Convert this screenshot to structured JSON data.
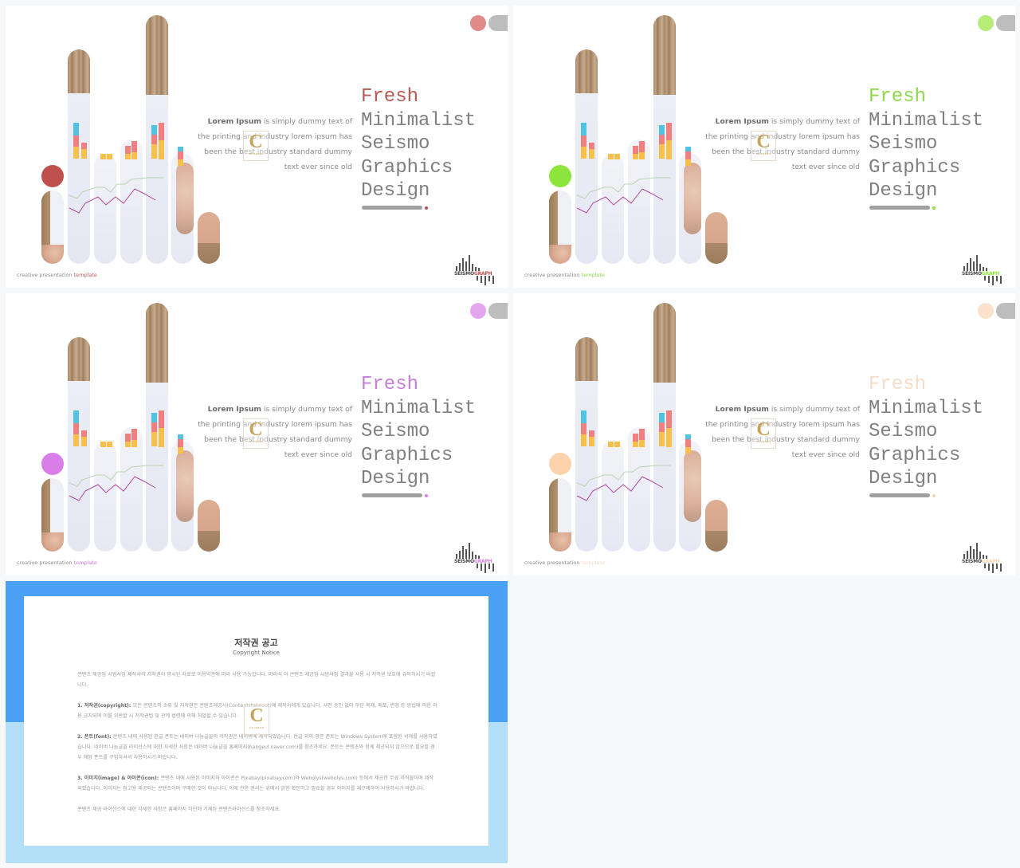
{
  "slides": [
    {
      "accent": "#c0504d",
      "top_dot_color": "#e08a8a",
      "title_color": "#b55a55",
      "body": {
        "bold": "Lorem Ipsum",
        "text": " is simply dummy text of the printing and industry lorem ipsum has been the best industry standard dummy text ever since old"
      },
      "title_lines": [
        "Fresh",
        "Minimalist",
        "Seismo",
        "Graphics",
        "Design"
      ],
      "footer": {
        "prefix": "creative presentation ",
        "highlight": "template"
      },
      "logo": {
        "left": "SEISMO",
        "right": "GRAPH"
      }
    },
    {
      "accent": "#8de43c",
      "top_dot_color": "#b6ec78",
      "title_color": "#8fd84c",
      "body": {
        "bold": "Lorem Ipsum",
        "text": " is simply dummy text of the printing and industry lorem ipsum has been the best industry standard dummy text ever since old"
      },
      "title_lines": [
        "Fresh",
        "Minimalist",
        "Seismo",
        "Graphics",
        "Design"
      ],
      "footer": {
        "prefix": "creative presentation ",
        "highlight": "template"
      },
      "logo": {
        "left": "SEISMO",
        "right": "GRAPH"
      }
    },
    {
      "accent": "#d97ee8",
      "top_dot_color": "#e4a6f0",
      "title_color": "#c77ed8",
      "body": {
        "bold": "Lorem Ipsum",
        "text": " is simply dummy text of the printing and industry lorem ipsum has been the best industry standard dummy text ever since old"
      },
      "title_lines": [
        "Fresh",
        "Minimalist",
        "Seismo",
        "Graphics",
        "Design"
      ],
      "footer": {
        "prefix": "creative presentation ",
        "highlight": "template"
      },
      "logo": {
        "left": "SEISMO",
        "right": "GRAPH"
      }
    },
    {
      "accent": "#fdd3ad",
      "top_dot_color": "#fbe0cb",
      "title_color": "#f6dcc8",
      "body": {
        "bold": "Lorem Ipsum",
        "text": " is simply dummy text of the printing and industry lorem ipsum has been the best industry standard dummy text ever since old"
      },
      "title_lines": [
        "Fresh",
        "Minimalist",
        "Seismo",
        "Graphics",
        "Design"
      ],
      "footer": {
        "prefix": "creative presentation ",
        "highlight": "template"
      },
      "logo": {
        "left": "SEISMO",
        "right": "GRAPH"
      }
    }
  ],
  "watermark": {
    "letter": "C",
    "sub": "KUL DESIGN"
  },
  "copyright": {
    "title": "저작권 공고",
    "subtitle": "Copyright Notice",
    "intro": "콘텐츠 제공업 시범사업 제작사의 저작권이 명시된 자료로 이용약관에 따라 사용 가능합니다. 따라서 이 콘텐츠 제공업 시범사업 결과물 사용 시 저작권 보호에 유의하시기 바랍니다.",
    "sections": [
      {
        "heading": "1. 저작권(copyright): ",
        "text": "모든 콘텐츠의 소유 및 저작권은 콘텐츠제공사(Contentstakeout)에 제작사에게 있습니다. 사전 승인 없이 무단 복제, 배포, 변경 등 방법에 의한 이용 금지되며 이를 위반할 시 저작권법 및 관계 법령에 의해 처벌될 수 있습니다."
      },
      {
        "heading": "2. 폰트(font): ",
        "text": "콘텐츠 내에 사용된 한글 폰트는 네이버 나눔글꼴의 저작권은 네이버에 제작되었습니다. 한글 외의 영문 폰트는 Windows System에 포함된 서체를 사용하였습니다. 네이버 나눔글꼴 라이선스에 대한 자세한 사항은 네이버 나눔글꼴 홈페이지(hangeul.naver.com)를 참조하세요. 폰트는 콘텐츠와 함께 제공되지 않으므로 필요할 경우 해당 폰트를 구입하셔서 사용하시기 바랍니다."
      },
      {
        "heading": "3. 이미지(image) & 아이콘(icon): ",
        "text": "콘텐츠 내에 사용된 이미지와 아이콘은 Pixabay(pixabay.com)와 Webolys(webolys.com) 등에서 제공한 무료 저작물이며 제작되었습니다. 이미지는 참고용 제공되는 콘텐츠이며 구매한 것이 아닙니다. 이에 관한 권리는 위에서 밝힌 확인하고 필요할 경우 이미지를 재구매하여 사용하시기 바랍니다."
      }
    ],
    "closing": "콘텐츠 제공 라이선스에 대한 자세한 사항은 홈페이지 하단에 기재된 콘텐츠라이선스를 참조하세요."
  }
}
